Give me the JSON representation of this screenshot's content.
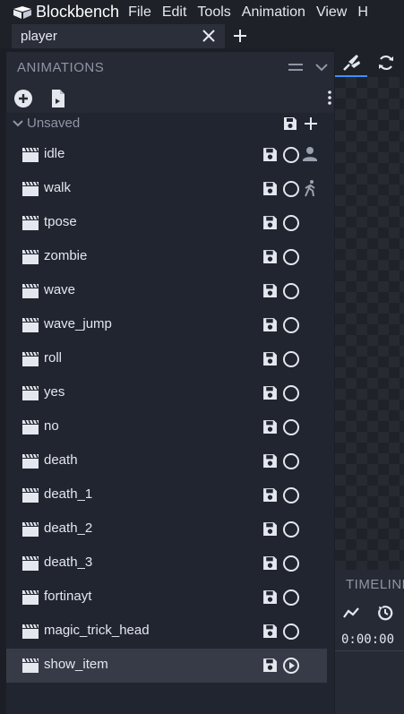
{
  "app": {
    "name": "Blockbench"
  },
  "menu": [
    "File",
    "Edit",
    "Tools",
    "Animation",
    "View",
    "H"
  ],
  "tabs": [
    {
      "label": "player"
    }
  ],
  "panel": {
    "title": "ANIMATIONS",
    "group": {
      "name": "Unsaved",
      "expanded": true
    },
    "animations": [
      {
        "name": "idle",
        "extra_icon": "person-icon",
        "selected": false
      },
      {
        "name": "walk",
        "extra_icon": "walking-person-icon",
        "selected": false
      },
      {
        "name": "tpose",
        "selected": false
      },
      {
        "name": "zombie",
        "selected": false
      },
      {
        "name": "wave",
        "selected": false
      },
      {
        "name": "wave_jump",
        "selected": false
      },
      {
        "name": "roll",
        "selected": false
      },
      {
        "name": "yes",
        "selected": false
      },
      {
        "name": "no",
        "selected": false
      },
      {
        "name": "death",
        "selected": false
      },
      {
        "name": "death_1",
        "selected": false
      },
      {
        "name": "death_2",
        "selected": false
      },
      {
        "name": "death_3",
        "selected": false
      },
      {
        "name": "fortinayt",
        "selected": false
      },
      {
        "name": "magic_trick_head",
        "selected": false
      },
      {
        "name": "show_item",
        "selected": true
      }
    ]
  },
  "timeline": {
    "title": "TIMELINE",
    "time": "0:00:00"
  },
  "colors": {
    "background": "#1c1e26",
    "panel": "#21252f",
    "selected_row": "#363b47",
    "accent": "#3e90ff",
    "text": "#e4e7ee",
    "muted_text": "#8e95a6"
  }
}
